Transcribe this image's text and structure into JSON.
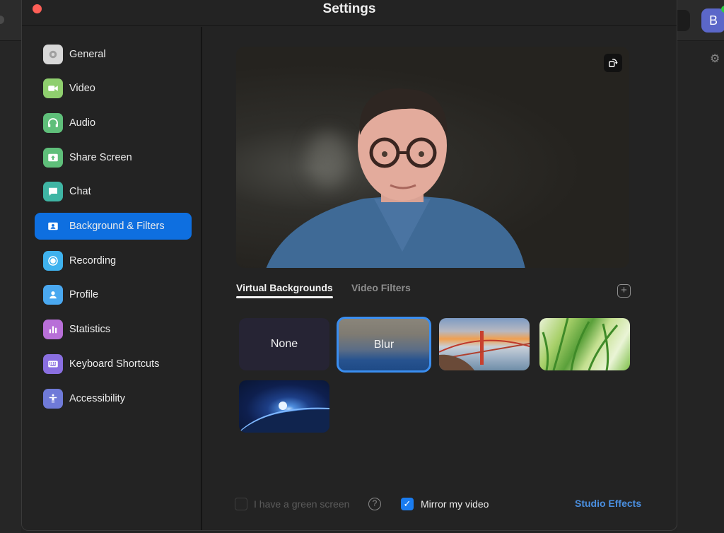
{
  "window": {
    "title": "Settings"
  },
  "background_app": {
    "avatar_initial": "B"
  },
  "sidebar": {
    "items": [
      {
        "label": "General",
        "icon": "gear-icon",
        "color": "#d8d8d8",
        "active": false
      },
      {
        "label": "Video",
        "icon": "video-camera-icon",
        "color": "#8fcf6e",
        "active": false
      },
      {
        "label": "Audio",
        "icon": "headphones-icon",
        "color": "#5fbf7a",
        "active": false
      },
      {
        "label": "Share Screen",
        "icon": "share-screen-icon",
        "color": "#5fbf7a",
        "active": false
      },
      {
        "label": "Chat",
        "icon": "chat-bubble-icon",
        "color": "#3fb5a4",
        "active": false
      },
      {
        "label": "Background & Filters",
        "icon": "person-card-icon",
        "color": "#0e6fe0",
        "active": true
      },
      {
        "label": "Recording",
        "icon": "record-icon",
        "color": "#3fb2ee",
        "active": false
      },
      {
        "label": "Profile",
        "icon": "profile-icon",
        "color": "#4aa8f0",
        "active": false
      },
      {
        "label": "Statistics",
        "icon": "bar-chart-icon",
        "color": "#b86fd8",
        "active": false
      },
      {
        "label": "Keyboard Shortcuts",
        "icon": "keyboard-icon",
        "color": "#8a6fe0",
        "active": false
      },
      {
        "label": "Accessibility",
        "icon": "accessibility-icon",
        "color": "#6f7ad8",
        "active": false
      }
    ]
  },
  "main": {
    "tabs": [
      {
        "label": "Virtual Backgrounds",
        "active": true
      },
      {
        "label": "Video Filters",
        "active": false
      }
    ],
    "backgrounds": [
      {
        "label": "None",
        "type": "none",
        "selected": false
      },
      {
        "label": "Blur",
        "type": "blur",
        "selected": true
      },
      {
        "label": "",
        "type": "golden-gate-bridge",
        "selected": false
      },
      {
        "label": "",
        "type": "grass",
        "selected": false
      },
      {
        "label": "",
        "type": "earth-from-space",
        "selected": false
      }
    ],
    "footer": {
      "green_screen_label": "I have a green screen",
      "green_screen_checked": false,
      "green_screen_enabled": false,
      "mirror_label": "Mirror my video",
      "mirror_checked": true,
      "studio_effects_label": "Studio Effects"
    }
  },
  "colors": {
    "accent": "#0e6fe0",
    "link": "#4a8fe0",
    "close_button": "#fe5f57"
  }
}
